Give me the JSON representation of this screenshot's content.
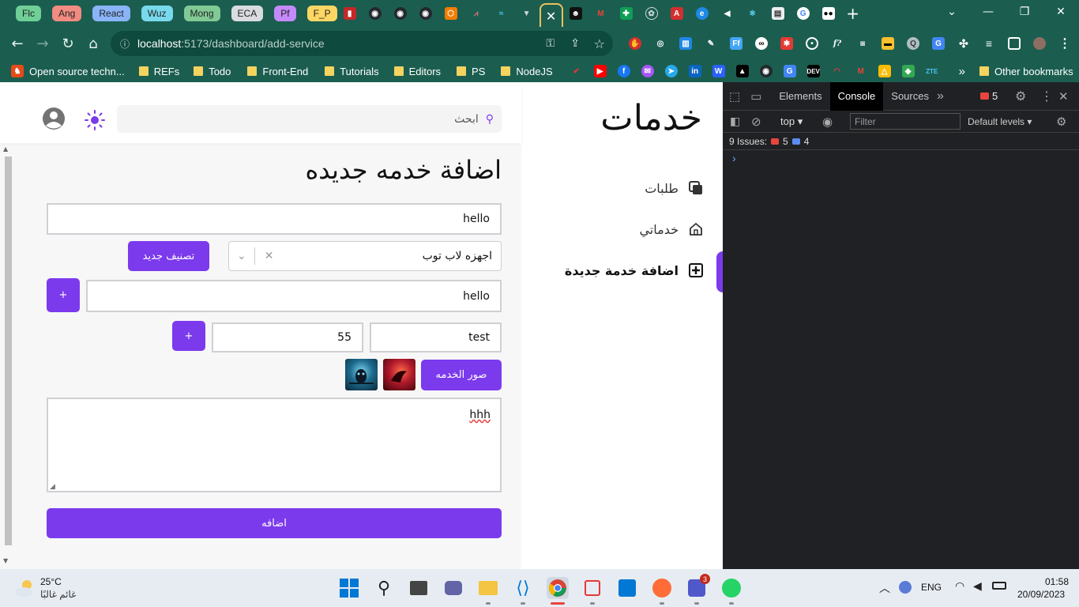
{
  "browser": {
    "tab_groups": [
      {
        "label": "Flc",
        "color": "#6fcf97"
      },
      {
        "label": "Ang",
        "color": "#f28b82"
      },
      {
        "label": "React",
        "color": "#8ab4f8"
      },
      {
        "label": "Wuz",
        "color": "#78d9ec"
      },
      {
        "label": "Mong",
        "color": "#81c995"
      },
      {
        "label": "ECA",
        "color": "#dadce0"
      },
      {
        "label": "Pf",
        "color": "#c58af9"
      },
      {
        "label": "F_P",
        "color": "#fdd663"
      }
    ],
    "active_tab_close": "✕",
    "url_host": "localhost",
    "url_path": ":5173/dashboard/add-service",
    "bookmarks": [
      {
        "label": "Open source techn...",
        "type": "site"
      },
      {
        "label": "REFs",
        "type": "folder"
      },
      {
        "label": "Todo",
        "type": "folder"
      },
      {
        "label": "Front-End",
        "type": "folder"
      },
      {
        "label": "Tutorials",
        "type": "folder"
      },
      {
        "label": "Editors",
        "type": "folder"
      },
      {
        "label": "PS",
        "type": "folder"
      },
      {
        "label": "NodeJS",
        "type": "folder"
      }
    ],
    "bookmarks_overflow": "»",
    "other_bookmarks": "Other bookmarks",
    "bookmark_icon_devto": "DEV",
    "bookmark_icon_zte": "ZTE"
  },
  "app": {
    "brand": "خدمات",
    "search_placeholder": "ابحث",
    "nav": [
      {
        "label": "طلبات",
        "icon": "copy-icon"
      },
      {
        "label": "خدماتي",
        "icon": "home-icon"
      },
      {
        "label": "اضافة خدمة جديدة",
        "icon": "plus-square-icon",
        "active": true
      }
    ],
    "accent": "#7c3aed",
    "form": {
      "title": "اضافة خدمه جديده",
      "name_value": "hello",
      "category_value": "اجهزه لاب توب",
      "new_category_button": "تصنيف جديد",
      "feature_value": "hello",
      "add_button": "+",
      "option_name_value": "test",
      "option_price_value": "55",
      "images_button": "صور الخدمه",
      "description_value": "hhh",
      "submit_button": "اضافه"
    }
  },
  "devtools": {
    "tabs": [
      "Elements",
      "Console",
      "Sources"
    ],
    "active_tab": "Console",
    "error_badge": "5",
    "context": "top",
    "filter_placeholder": "Filter",
    "levels": "Default levels",
    "issues_label": "9 Issues:",
    "issues_errors": "5",
    "issues_info": "4",
    "prompt": "›"
  },
  "taskbar": {
    "weather_temp": "25°C",
    "weather_desc": "غائم غالبًا",
    "language": "ENG",
    "time": "01:58",
    "date": "20/09/2023",
    "teams_badge": "3"
  }
}
